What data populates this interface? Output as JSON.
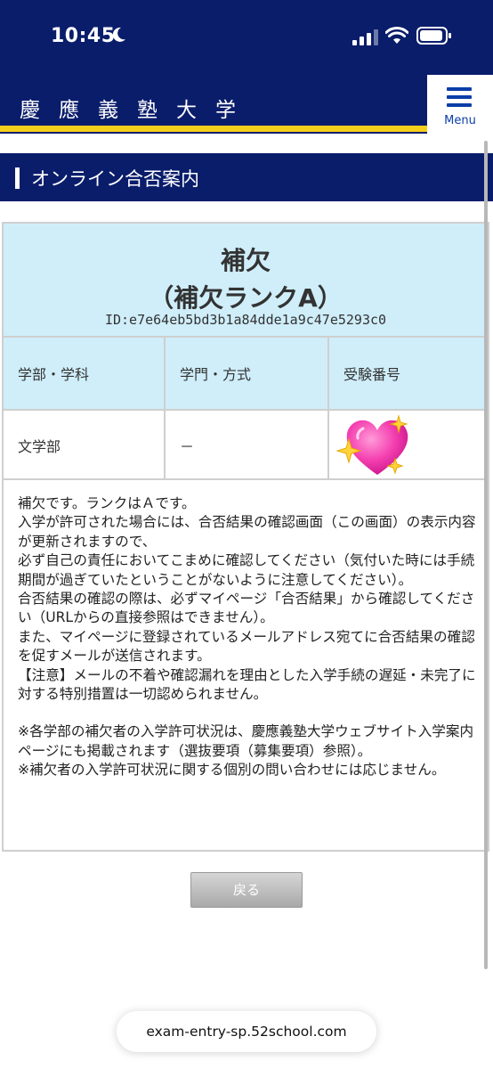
{
  "status_bar": {
    "time": "10:45"
  },
  "header": {
    "university": "慶應義塾大学",
    "menu_label": "Menu"
  },
  "section": {
    "title": "オンライン合否案内"
  },
  "result": {
    "status": "補欠",
    "rank": "（補欠ランクA）",
    "id": "ID:e7e64eb5bd3b1a84dde1a9c47e5293c0",
    "columns": [
      "学部・学科",
      "学門・方式",
      "受験番号"
    ],
    "row": {
      "faculty": "文学部",
      "method": "－"
    },
    "notice": [
      "補欠です。ランクはＡです。",
      "入学が許可された場合には、合否結果の確認画面（この画面）の表示内容が更新されますので、",
      "必ず自己の責任においてこまめに確認してください（気付いた時には手続期間が過ぎていたということがないように注意してください）。",
      "合否結果の確認の際は、必ずマイページ「合否結果」から確認してください（URLからの直接参照はできません）。",
      "また、マイページに登録されているメールアドレス宛てに合否結果の確認を促すメールが送信されます。",
      "【注意】メールの不着や確認漏れを理由とした入学手続の遅延・未完了に対する特別措置は一切認められません。",
      "",
      "※各学部の補欠者の入学許可状況は、慶應義塾大学ウェブサイト入学案内ページにも掲載されます（選抜要項（募集要項）参照）。",
      "※補欠者の入学許可状況に関する個別の問い合わせには応じません。"
    ]
  },
  "back_button": "戻る",
  "browser": {
    "url": "exam-entry-sp.52school.com"
  },
  "colors": {
    "navy": "#0a1d6b",
    "accent_yellow": "#f6cf1a",
    "light_blue": "#cfeefa",
    "menu_blue": "#0a3ea8"
  },
  "icons": [
    "moon-icon",
    "signal-icon",
    "wifi-icon",
    "battery-icon",
    "hamburger-menu-icon",
    "sparkling-heart-icon"
  ]
}
